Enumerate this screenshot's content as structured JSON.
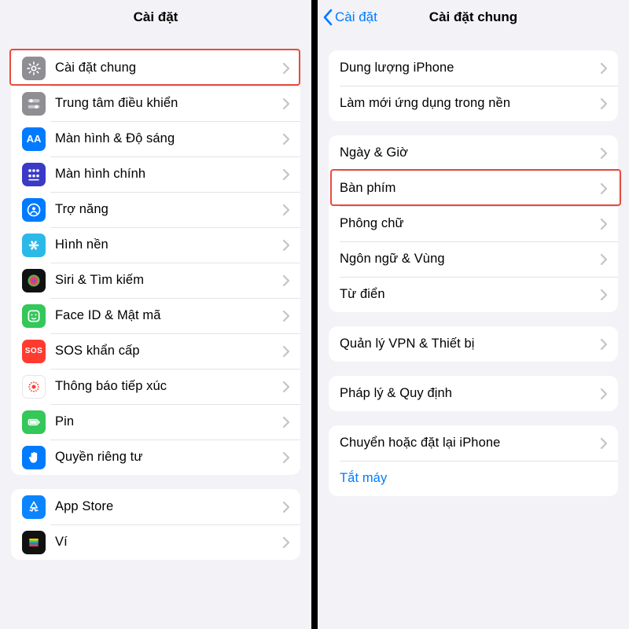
{
  "left": {
    "title": "Cài đặt",
    "highlight_row": 0,
    "groups": [
      {
        "rows": [
          {
            "id": "general",
            "label": "Cài đặt chung",
            "icon": "gear",
            "color": "#8e8e93"
          },
          {
            "id": "control",
            "label": "Trung tâm điều khiển",
            "icon": "sliders",
            "color": "#8e8e93"
          },
          {
            "id": "display",
            "label": "Màn hình & Độ sáng",
            "icon": "AA",
            "color": "#007aff"
          },
          {
            "id": "home",
            "label": "Màn hình chính",
            "icon": "grid",
            "color": "#3a3ac7"
          },
          {
            "id": "accessibility",
            "label": "Trợ năng",
            "icon": "person",
            "color": "#007aff"
          },
          {
            "id": "wallpaper",
            "label": "Hình nền",
            "icon": "flower",
            "color": "#2bb9e8"
          },
          {
            "id": "siri",
            "label": "Siri & Tìm kiếm",
            "icon": "siri",
            "color": "#111"
          },
          {
            "id": "faceid",
            "label": "Face ID & Mật mã",
            "icon": "face",
            "color": "#34c759"
          },
          {
            "id": "sos",
            "label": "SOS khẩn cấp",
            "icon": "SOS",
            "color": "#ff3b30"
          },
          {
            "id": "exposure",
            "label": "Thông báo tiếp xúc",
            "icon": "exposure",
            "color": "#fff",
            "fg": "#ff3b30",
            "border": true
          },
          {
            "id": "battery",
            "label": "Pin",
            "icon": "battery",
            "color": "#34c759"
          },
          {
            "id": "privacy",
            "label": "Quyền riêng tư",
            "icon": "hand",
            "color": "#007aff"
          }
        ]
      },
      {
        "rows": [
          {
            "id": "appstore",
            "label": "App Store",
            "icon": "appstore",
            "color": "#0a84ff"
          },
          {
            "id": "wallet",
            "label": "Ví",
            "icon": "wallet",
            "color": "#111"
          }
        ]
      }
    ]
  },
  "right": {
    "back": "Cài đặt",
    "title": "Cài đặt chung",
    "highlight": {
      "group": 1,
      "row": 1
    },
    "groups": [
      {
        "rows": [
          {
            "id": "storage",
            "label": "Dung lượng iPhone"
          },
          {
            "id": "bgapp",
            "label": "Làm mới ứng dụng trong nền"
          }
        ]
      },
      {
        "rows": [
          {
            "id": "datetime",
            "label": "Ngày & Giờ"
          },
          {
            "id": "keyboard",
            "label": "Bàn phím"
          },
          {
            "id": "fonts",
            "label": "Phông chữ"
          },
          {
            "id": "lang",
            "label": "Ngôn ngữ & Vùng"
          },
          {
            "id": "dict",
            "label": "Từ điển"
          }
        ]
      },
      {
        "rows": [
          {
            "id": "vpn",
            "label": "Quản lý VPN & Thiết bị"
          }
        ]
      },
      {
        "rows": [
          {
            "id": "legal",
            "label": "Pháp lý & Quy định"
          }
        ]
      },
      {
        "rows": [
          {
            "id": "reset",
            "label": "Chuyển hoặc đặt lại iPhone"
          },
          {
            "id": "shutdown",
            "label": "Tắt máy",
            "link": true,
            "no_chevron": true
          }
        ]
      }
    ]
  }
}
